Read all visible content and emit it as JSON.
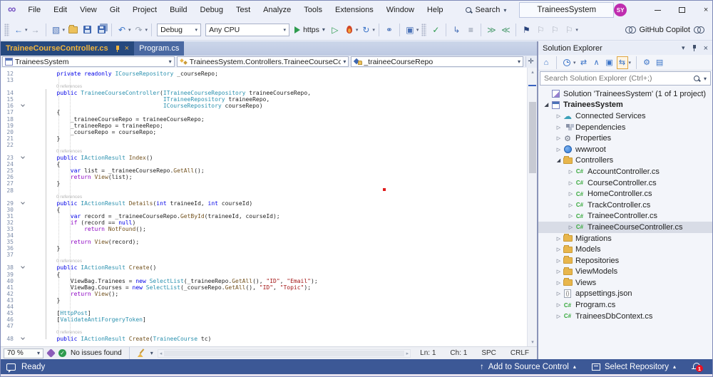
{
  "title_bar": {
    "menus": [
      "File",
      "Edit",
      "View",
      "Git",
      "Project",
      "Build",
      "Debug",
      "Test",
      "Analyze",
      "Tools",
      "Extensions",
      "Window",
      "Help"
    ],
    "search_label": "Search",
    "window_title": "TraineesSystem",
    "avatar_initials": "SY"
  },
  "toolbar": {
    "debug_config": "Debug",
    "platform": "Any CPU",
    "run_target": "https",
    "copilot_label": "GitHub Copilot",
    "icons": [
      {
        "t": "grip"
      },
      {
        "t": "ico",
        "n": "nav-back-icon",
        "g": "←",
        "c": "#3b74c8"
      },
      {
        "t": "car"
      },
      {
        "t": "ico",
        "n": "nav-forward-icon",
        "g": "→",
        "c": "#9aa3b2"
      },
      {
        "t": "sep"
      },
      {
        "t": "ico",
        "n": "new-project-icon",
        "g": "▧",
        "c": "#4b73b8"
      },
      {
        "t": "car"
      },
      {
        "t": "ico",
        "n": "open-folder-icon",
        "cls": "i-folder"
      },
      {
        "t": "ico",
        "n": "save-icon",
        "cls": "i-floppy"
      },
      {
        "t": "ico",
        "n": "save-all-icon",
        "cls": "i-floppy i-floppy2"
      },
      {
        "t": "sep"
      },
      {
        "t": "ico",
        "n": "undo-icon",
        "g": "↶",
        "c": "#3b74c8"
      },
      {
        "t": "car"
      },
      {
        "t": "ico",
        "n": "redo-icon",
        "g": "↷",
        "c": "#9aa3b2"
      },
      {
        "t": "car"
      },
      {
        "t": "sep"
      },
      {
        "t": "combo",
        "n": "debug-config-select",
        "bind": "toolbar.debug_config",
        "w": 62
      },
      {
        "t": "combo",
        "n": "platform-select",
        "bind": "toolbar.platform",
        "w": 118
      },
      {
        "t": "run"
      },
      {
        "t": "ico",
        "n": "start-without-debugging-icon",
        "g": "▷",
        "c": "#2e9b4e"
      },
      {
        "t": "ico",
        "n": "hot-reload-icon",
        "cls": "i-flame"
      },
      {
        "t": "car"
      },
      {
        "t": "ico",
        "n": "restart-icon",
        "g": "↻",
        "c": "#3b74c8"
      },
      {
        "t": "car"
      },
      {
        "t": "sep"
      },
      {
        "t": "ico",
        "n": "find-in-files-icon",
        "g": "⚭",
        "c": "#4b73b8"
      },
      {
        "t": "sep"
      },
      {
        "t": "ico",
        "n": "preview-window-icon",
        "g": "▣",
        "c": "#4b73b8"
      },
      {
        "t": "car"
      },
      {
        "t": "grip"
      },
      {
        "t": "ico",
        "n": "spell-check-icon",
        "g": "✓",
        "c": "#2e9b4e"
      },
      {
        "t": "sep"
      },
      {
        "t": "ico",
        "n": "view-code-icon",
        "g": "↳",
        "c": "#4b73b8"
      },
      {
        "t": "ico",
        "n": "format-document-icon",
        "g": "≡",
        "c": "#7a8699"
      },
      {
        "t": "sep"
      },
      {
        "t": "ico",
        "n": "increase-indent-icon",
        "g": "≫",
        "c": "#4b9b6e"
      },
      {
        "t": "ico",
        "n": "decrease-indent-icon",
        "g": "≪",
        "c": "#4b9b6e"
      },
      {
        "t": "sep"
      },
      {
        "t": "ico",
        "n": "bookmark-icon",
        "g": "⚑",
        "c": "#27417a"
      },
      {
        "t": "ico",
        "n": "prev-bookmark-icon",
        "g": "⚐",
        "c": "#a9afbb"
      },
      {
        "t": "ico",
        "n": "next-bookmark-icon",
        "g": "⚐",
        "c": "#a9afbb"
      },
      {
        "t": "ico",
        "n": "clear-bookmarks-icon",
        "g": "⚐",
        "c": "#a9afbb"
      },
      {
        "t": "car"
      }
    ]
  },
  "tabs": [
    {
      "label": "TraineeCourseController.cs",
      "active": true
    },
    {
      "label": "Program.cs",
      "active": false
    }
  ],
  "navbar": {
    "project": "TraineesSystem",
    "type": "TraineesSystem.Controllers.TraineeCourseController",
    "member": "_traineeCourseRepo"
  },
  "editor": {
    "codelens_label": "0 references",
    "fold_lines": [
      16,
      23,
      29,
      38,
      48
    ],
    "lines": [
      {
        "n": 12,
        "seg": [
          [
            "p",
            "        "
          ],
          [
            "k",
            "private"
          ],
          [
            "p",
            " "
          ],
          [
            "k",
            "readonly"
          ],
          [
            "p",
            " "
          ],
          [
            "t",
            "ICourseRepository"
          ],
          [
            "p",
            " _courseRepo;"
          ]
        ]
      },
      {
        "n": 13,
        "seg": []
      },
      {
        "n": 14,
        "lens": true,
        "seg": [
          [
            "p",
            "        "
          ],
          [
            "k",
            "public"
          ],
          [
            "p",
            " "
          ],
          [
            "t",
            "TraineeCourseController"
          ],
          [
            "p",
            "("
          ],
          [
            "t",
            "ITraineeCourseRepository"
          ],
          [
            "p",
            " traineeCourseRepo,"
          ]
        ]
      },
      {
        "n": 15,
        "seg": [
          [
            "p",
            "                                       "
          ],
          [
            "t",
            "ITraineeRepository"
          ],
          [
            "p",
            " traineeRepo,"
          ]
        ]
      },
      {
        "n": 16,
        "seg": [
          [
            "p",
            "                                       "
          ],
          [
            "t",
            "ICourseRepository"
          ],
          [
            "p",
            " courseRepo)"
          ]
        ]
      },
      {
        "n": 17,
        "seg": [
          [
            "p",
            "        {"
          ]
        ]
      },
      {
        "n": 18,
        "seg": [
          [
            "p",
            "            _traineeCourseRepo = traineeCourseRepo;"
          ]
        ]
      },
      {
        "n": 19,
        "seg": [
          [
            "p",
            "            _traineeRepo = traineeRepo;"
          ]
        ]
      },
      {
        "n": 20,
        "seg": [
          [
            "p",
            "            _courseRepo = courseRepo;"
          ]
        ]
      },
      {
        "n": 21,
        "seg": [
          [
            "p",
            "        }"
          ]
        ]
      },
      {
        "n": 22,
        "seg": []
      },
      {
        "n": 23,
        "lens": true,
        "seg": [
          [
            "p",
            "        "
          ],
          [
            "k",
            "public"
          ],
          [
            "p",
            " "
          ],
          [
            "t",
            "IActionResult"
          ],
          [
            "p",
            " "
          ],
          [
            "m",
            "Index"
          ],
          [
            "p",
            "()"
          ]
        ]
      },
      {
        "n": 24,
        "seg": [
          [
            "p",
            "        {"
          ]
        ]
      },
      {
        "n": 25,
        "seg": [
          [
            "p",
            "            "
          ],
          [
            "k",
            "var"
          ],
          [
            "p",
            " list = _traineeCourseRepo."
          ],
          [
            "m",
            "GetAll"
          ],
          [
            "p",
            "();"
          ]
        ]
      },
      {
        "n": 26,
        "seg": [
          [
            "p",
            "            "
          ],
          [
            "c",
            "return"
          ],
          [
            "p",
            " "
          ],
          [
            "m",
            "View"
          ],
          [
            "p",
            "(list);"
          ]
        ]
      },
      {
        "n": 27,
        "seg": [
          [
            "p",
            "        }"
          ]
        ]
      },
      {
        "n": 28,
        "seg": []
      },
      {
        "n": 29,
        "lens": true,
        "seg": [
          [
            "p",
            "        "
          ],
          [
            "k",
            "public"
          ],
          [
            "p",
            " "
          ],
          [
            "t",
            "IActionResult"
          ],
          [
            "p",
            " "
          ],
          [
            "m",
            "Details"
          ],
          [
            "p",
            "("
          ],
          [
            "k",
            "int"
          ],
          [
            "p",
            " traineeId, "
          ],
          [
            "k",
            "int"
          ],
          [
            "p",
            " courseId)"
          ]
        ]
      },
      {
        "n": 30,
        "seg": [
          [
            "p",
            "        {"
          ]
        ]
      },
      {
        "n": 31,
        "seg": [
          [
            "p",
            "            "
          ],
          [
            "k",
            "var"
          ],
          [
            "p",
            " record = _traineeCourseRepo."
          ],
          [
            "m",
            "GetById"
          ],
          [
            "p",
            "(traineeId, courseId);"
          ]
        ]
      },
      {
        "n": 32,
        "seg": [
          [
            "p",
            "            "
          ],
          [
            "c",
            "if"
          ],
          [
            "p",
            " (record == "
          ],
          [
            "k",
            "null"
          ],
          [
            "p",
            ")"
          ]
        ]
      },
      {
        "n": 33,
        "seg": [
          [
            "p",
            "                "
          ],
          [
            "c",
            "return"
          ],
          [
            "p",
            " "
          ],
          [
            "m",
            "NotFound"
          ],
          [
            "p",
            "();"
          ]
        ]
      },
      {
        "n": 34,
        "seg": []
      },
      {
        "n": 35,
        "seg": [
          [
            "p",
            "            "
          ],
          [
            "c",
            "return"
          ],
          [
            "p",
            " "
          ],
          [
            "m",
            "View"
          ],
          [
            "p",
            "(record);"
          ]
        ]
      },
      {
        "n": 36,
        "seg": [
          [
            "p",
            "        }"
          ]
        ]
      },
      {
        "n": 37,
        "seg": []
      },
      {
        "n": 38,
        "lens": true,
        "seg": [
          [
            "p",
            "        "
          ],
          [
            "k",
            "public"
          ],
          [
            "p",
            " "
          ],
          [
            "t",
            "IActionResult"
          ],
          [
            "p",
            " "
          ],
          [
            "m",
            "Create"
          ],
          [
            "p",
            "()"
          ]
        ]
      },
      {
        "n": 39,
        "seg": [
          [
            "p",
            "        {"
          ]
        ]
      },
      {
        "n": 40,
        "seg": [
          [
            "p",
            "            ViewBag.Trainees = "
          ],
          [
            "k",
            "new"
          ],
          [
            "p",
            " "
          ],
          [
            "t",
            "SelectList"
          ],
          [
            "p",
            "(_traineeRepo."
          ],
          [
            "m",
            "GetAll"
          ],
          [
            "p",
            "(), "
          ],
          [
            "s",
            "\"ID\""
          ],
          [
            "p",
            ", "
          ],
          [
            "s",
            "\"Email\""
          ],
          [
            "p",
            ");"
          ]
        ]
      },
      {
        "n": 41,
        "seg": [
          [
            "p",
            "            ViewBag.Courses = "
          ],
          [
            "k",
            "new"
          ],
          [
            "p",
            " "
          ],
          [
            "t",
            "SelectList"
          ],
          [
            "p",
            "(_courseRepo."
          ],
          [
            "m",
            "GetAll"
          ],
          [
            "p",
            "(), "
          ],
          [
            "s",
            "\"ID\""
          ],
          [
            "p",
            ", "
          ],
          [
            "s",
            "\"Topic\""
          ],
          [
            "p",
            ");"
          ]
        ]
      },
      {
        "n": 42,
        "seg": [
          [
            "p",
            "            "
          ],
          [
            "c",
            "return"
          ],
          [
            "p",
            " "
          ],
          [
            "m",
            "View"
          ],
          [
            "p",
            "();"
          ]
        ]
      },
      {
        "n": 43,
        "seg": [
          [
            "p",
            "        }"
          ]
        ]
      },
      {
        "n": 44,
        "seg": []
      },
      {
        "n": 45,
        "seg": [
          [
            "p",
            "        ["
          ],
          [
            "t",
            "HttpPost"
          ],
          [
            "p",
            "]"
          ]
        ]
      },
      {
        "n": 46,
        "seg": [
          [
            "p",
            "        ["
          ],
          [
            "t",
            "ValidateAntiForgeryToken"
          ],
          [
            "p",
            "]"
          ]
        ]
      },
      {
        "n": 47,
        "seg": []
      },
      {
        "n": 48,
        "lens": true,
        "seg": [
          [
            "p",
            "        "
          ],
          [
            "k",
            "public"
          ],
          [
            "p",
            " "
          ],
          [
            "t",
            "IActionResult"
          ],
          [
            "p",
            " "
          ],
          [
            "m",
            "Create"
          ],
          [
            "p",
            "("
          ],
          [
            "t",
            "TraineeCourse"
          ],
          [
            "p",
            " tc)"
          ]
        ]
      }
    ]
  },
  "editor_status": {
    "zoom": "70 %",
    "issues": "No issues found",
    "line": "Ln: 1",
    "column": "Ch: 1",
    "spaces": "SPC",
    "line_ending": "CRLF"
  },
  "solution_explorer": {
    "title": "Solution Explorer",
    "search_placeholder": "Search Solution Explorer (Ctrl+;)",
    "toolbar_icons": [
      {
        "n": "switch-views-icon",
        "g": "⌂"
      },
      {
        "t": "sep"
      },
      {
        "n": "pending-changes-filter-icon",
        "cls": "i-clock"
      },
      {
        "t": "car"
      },
      {
        "n": "refresh-icon",
        "g": "⇄"
      },
      {
        "n": "collapse-all-icon",
        "g": "∧"
      },
      {
        "n": "preview-selected-icon",
        "g": "▣"
      },
      {
        "n": "sync-with-active-document-icon",
        "g": "⇆",
        "hl": true
      },
      {
        "t": "car"
      },
      {
        "t": "sep"
      },
      {
        "n": "properties-icon",
        "g": "⚙"
      },
      {
        "n": "show-all-files-icon",
        "g": "▤"
      }
    ],
    "tree": [
      {
        "d": 0,
        "icon": "solution",
        "label": "Solution 'TraineesSystem' (1 of 1 project)"
      },
      {
        "d": 0,
        "icon": "project",
        "label": "TraineesSystem",
        "exp": "open",
        "bold": true
      },
      {
        "d": 1,
        "icon": "cloud",
        "label": "Connected Services",
        "exp": "closed"
      },
      {
        "d": 1,
        "icon": "dependencies",
        "label": "Dependencies",
        "exp": "closed"
      },
      {
        "d": 1,
        "icon": "properties",
        "label": "Properties",
        "exp": "closed"
      },
      {
        "d": 1,
        "icon": "globe",
        "label": "wwwroot",
        "exp": "closed"
      },
      {
        "d": 1,
        "icon": "folder",
        "label": "Controllers",
        "exp": "open"
      },
      {
        "d": 2,
        "icon": "csharp",
        "label": "AccountController.cs",
        "exp": "closed"
      },
      {
        "d": 2,
        "icon": "csharp",
        "label": "CourseController.cs",
        "exp": "closed"
      },
      {
        "d": 2,
        "icon": "csharp",
        "label": "HomeController.cs",
        "exp": "closed"
      },
      {
        "d": 2,
        "icon": "csharp",
        "label": "TrackController.cs",
        "exp": "closed"
      },
      {
        "d": 2,
        "icon": "csharp",
        "label": "TraineeController.cs",
        "exp": "closed"
      },
      {
        "d": 2,
        "icon": "csharp",
        "label": "TraineeCourseController.cs",
        "exp": "closed",
        "selected": true
      },
      {
        "d": 1,
        "icon": "folder",
        "label": "Migrations",
        "exp": "closed"
      },
      {
        "d": 1,
        "icon": "folder",
        "label": "Models",
        "exp": "closed"
      },
      {
        "d": 1,
        "icon": "folder",
        "label": "Repositories",
        "exp": "closed"
      },
      {
        "d": 1,
        "icon": "folder",
        "label": "ViewModels",
        "exp": "closed"
      },
      {
        "d": 1,
        "icon": "folder",
        "label": "Views",
        "exp": "closed"
      },
      {
        "d": 1,
        "icon": "json",
        "label": "appsettings.json",
        "exp": "closed"
      },
      {
        "d": 1,
        "icon": "csharp",
        "label": "Program.cs",
        "exp": "closed"
      },
      {
        "d": 1,
        "icon": "csharp",
        "label": "TraineesDbContext.cs",
        "exp": "closed"
      }
    ]
  },
  "status_bar": {
    "ready": "Ready",
    "add_to_source_control": "Add to Source Control",
    "select_repository": "Select Repository",
    "notification_count": "1"
  }
}
